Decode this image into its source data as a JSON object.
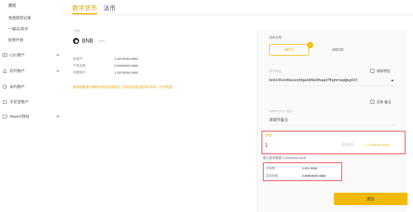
{
  "sidebar": {
    "items": [
      {
        "label": "提现",
        "active": true,
        "icon": "none"
      },
      {
        "label": "充值提现记录",
        "active": false,
        "icon": "none"
      },
      {
        "label": "一键买/卖币",
        "active": false,
        "icon": "none"
      },
      {
        "label": "经常开放",
        "active": false,
        "icon": "none"
      },
      {
        "label": "C2C账户",
        "active": false,
        "icon": "c2c-icon",
        "expandable": true
      },
      {
        "label": "杠杆账户",
        "active": false,
        "icon": "margin-icon",
        "expandable": true
      },
      {
        "label": "合约账户",
        "active": false,
        "icon": "futures-icon"
      },
      {
        "label": "币安宝账户",
        "active": false,
        "icon": "savings-icon"
      },
      {
        "label": "WazirX钱包",
        "active": false,
        "icon": "wallet-icon",
        "expandable": true
      }
    ]
  },
  "tabs": [
    {
      "label": "数字货币",
      "active": true
    },
    {
      "label": "法币",
      "active": false
    }
  ],
  "coin": {
    "field_label": "币种",
    "symbol": "BNB",
    "name": "BNB"
  },
  "balances": [
    {
      "label": "总资产:",
      "value": "1.16705354 BNB"
    },
    {
      "label": "下单冻结:",
      "value": "0.00000000 BNB"
    },
    {
      "label": "可用资产:",
      "value": "1.16705354 BNB"
    }
  ],
  "notice": "重要提醒请仔细核对地址后再提现，否则可能会造成资产损失（不可找回）",
  "form": {
    "network_label": "选择主网:",
    "networks": [
      {
        "label": "BEP2",
        "selected": true
      },
      {
        "label": "ERC20",
        "selected": false
      }
    ],
    "address_label": "提币地址",
    "address_value": "bnb136vnd9wszsh9gan89w0lhaad7fhqhmaqlgkgrl23",
    "save_address_label": "保存地址",
    "no_memo_label": "没有  备注",
    "memo_label": "MEMO/TAG  备注",
    "memo_value": "请填写备注",
    "amount_label": "数量",
    "amount_value": "1",
    "available_label": "可用资产:",
    "available_value": "1.16705354 BNB",
    "min_amount": "最小提币数量 0.00000000 BNB",
    "fee_label": "手续费:",
    "fee_value": "0.001 BNB",
    "received_label": "实际到账:",
    "received_value": "0.99900000 BNB",
    "submit_label": "提交"
  },
  "colors": {
    "accent": "#f0b90b",
    "highlight_border": "#e53935"
  }
}
